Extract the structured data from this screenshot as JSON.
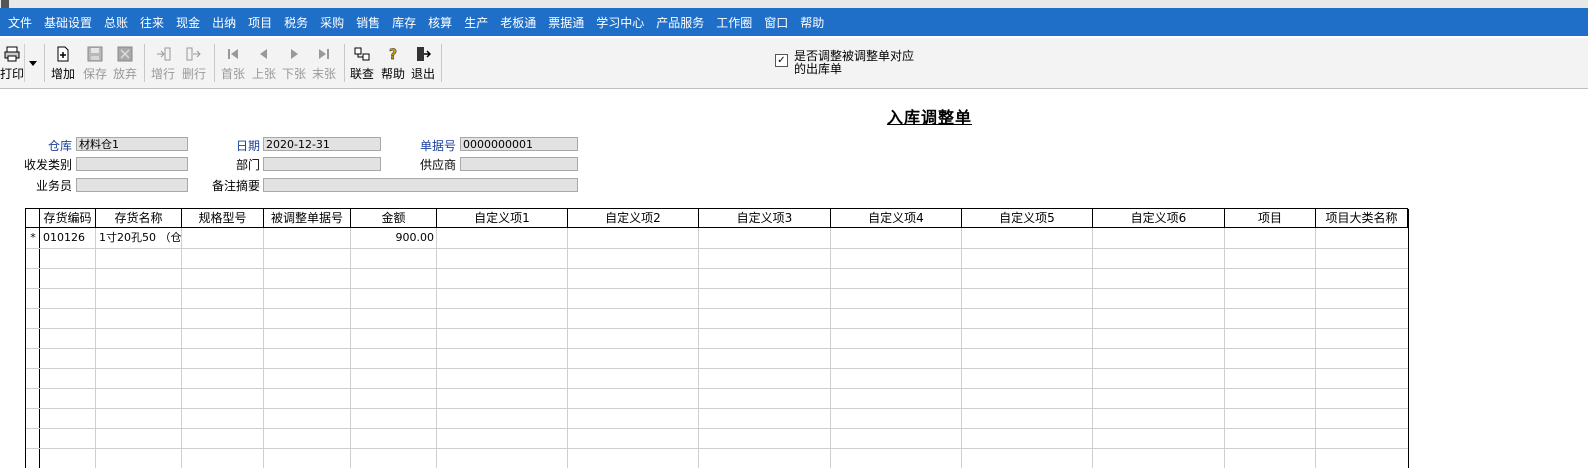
{
  "menu": {
    "items": [
      "文件",
      "基础设置",
      "总账",
      "往来",
      "现金",
      "出纳",
      "项目",
      "税务",
      "采购",
      "销售",
      "库存",
      "核算",
      "生产",
      "老板通",
      "票据通",
      "学习中心",
      "产品服务",
      "工作圈",
      "窗口",
      "帮助"
    ]
  },
  "toolbar": {
    "print": "打印",
    "add": "增加",
    "save": "保存",
    "discard": "放弃",
    "add_row": "增行",
    "delete_row": "删行",
    "first": "首张",
    "prev": "上张",
    "next": "下张",
    "last": "末张",
    "linked_query": "联查",
    "help": "帮助",
    "exit": "退出"
  },
  "option": {
    "checked_mark": "✓",
    "label": "是否调整被调整单对应的出库单"
  },
  "form": {
    "title": "入库调整单",
    "warehouse_label": "仓库",
    "warehouse_value": "材料仓1",
    "date_label": "日期",
    "date_value": "2020-12-31",
    "docno_label": "单据号",
    "docno_value": "0000000001",
    "category_label": "收发类别",
    "category_value": "",
    "dept_label": "部门",
    "dept_value": "",
    "supplier_label": "供应商",
    "supplier_value": "",
    "clerk_label": "业务员",
    "clerk_value": "",
    "remark_label": "备注摘要",
    "remark_value": ""
  },
  "grid": {
    "columns": [
      "",
      "存货编码",
      "存货名称",
      "规格型号",
      "被调整单据号",
      "金额",
      "自定义项1",
      "自定义项2",
      "自定义项3",
      "自定义项4",
      "自定义项5",
      "自定义项6",
      "项目",
      "项目大类名称"
    ],
    "rows": [
      {
        "marker": "*",
        "code": "010126",
        "name": "1寸20孔50 （仓",
        "spec": "",
        "ref_doc": "",
        "amount": "900.00"
      }
    ]
  },
  "colors": {
    "menubar": "#1f6fc8",
    "blue_label": "#1a3f9b"
  }
}
